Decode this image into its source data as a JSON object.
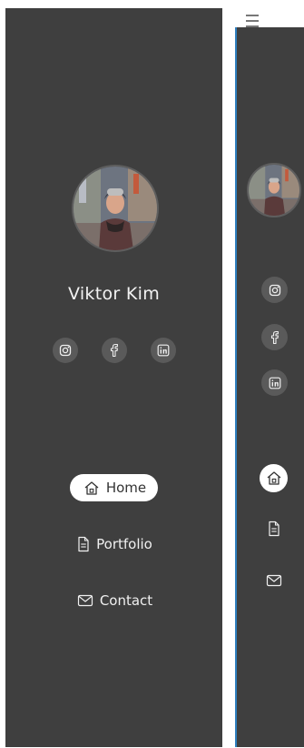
{
  "profile": {
    "name": "Viktor Kim",
    "avatar": "portrait-photo"
  },
  "social": [
    {
      "icon": "instagram-icon"
    },
    {
      "icon": "facebook-icon"
    },
    {
      "icon": "linkedin-icon"
    }
  ],
  "nav": {
    "items": [
      {
        "label": "Home",
        "icon": "home-icon",
        "active": true
      },
      {
        "label": "Portfolio",
        "icon": "document-icon",
        "active": false
      },
      {
        "label": "Contact",
        "icon": "mail-icon",
        "active": false
      }
    ]
  },
  "colors": {
    "panel": "#3f3f3f",
    "chip": "#5a5a5a",
    "active_pill": "#ffffff",
    "text": "#f0f0f0",
    "accent_border": "#2f7fbf"
  }
}
